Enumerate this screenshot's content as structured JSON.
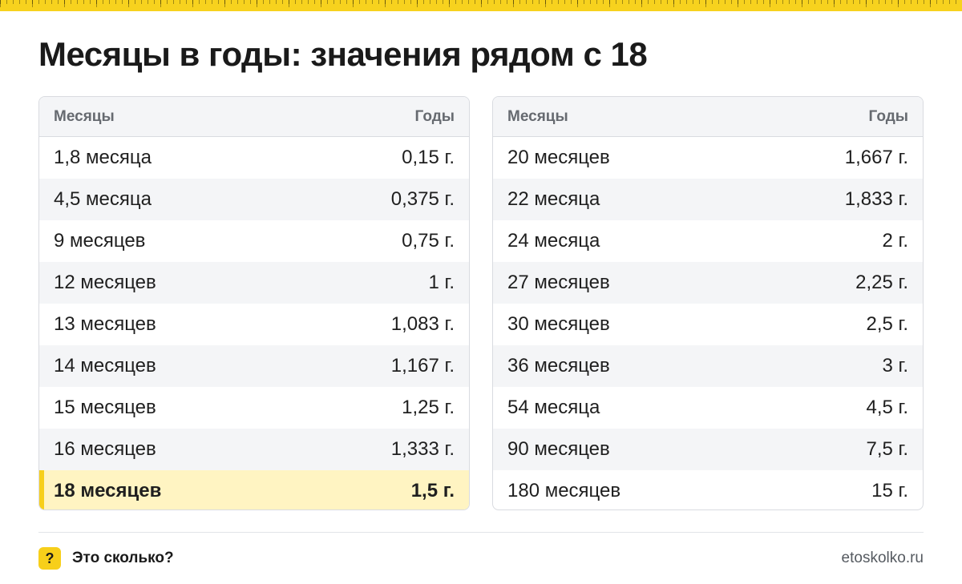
{
  "title": "Месяцы в годы: значения рядом с 18",
  "colors": {
    "accent": "#f7cf1a",
    "highlight_bg": "#fff4c2",
    "header_bg": "#f4f5f7"
  },
  "tables": [
    {
      "headers": {
        "months": "Месяцы",
        "years": "Годы"
      },
      "rows": [
        {
          "months": "1,8 месяца",
          "years": "0,15 г."
        },
        {
          "months": "4,5 месяца",
          "years": "0,375 г."
        },
        {
          "months": "9 месяцев",
          "years": "0,75 г."
        },
        {
          "months": "12 месяцев",
          "years": "1 г."
        },
        {
          "months": "13 месяцев",
          "years": "1,083 г."
        },
        {
          "months": "14 месяцев",
          "years": "1,167 г."
        },
        {
          "months": "15 месяцев",
          "years": "1,25 г."
        },
        {
          "months": "16 месяцев",
          "years": "1,333 г."
        },
        {
          "months": "18 месяцев",
          "years": "1,5 г."
        }
      ]
    },
    {
      "headers": {
        "months": "Месяцы",
        "years": "Годы"
      },
      "rows": [
        {
          "months": "20 месяцев",
          "years": "1,667 г."
        },
        {
          "months": "22 месяца",
          "years": "1,833 г."
        },
        {
          "months": "24 месяца",
          "years": "2 г."
        },
        {
          "months": "27 месяцев",
          "years": "2,25 г."
        },
        {
          "months": "30 месяцев",
          "years": "2,5 г."
        },
        {
          "months": "36 месяцев",
          "years": "3 г."
        },
        {
          "months": "54 месяца",
          "years": "4,5 г."
        },
        {
          "months": "90 месяцев",
          "years": "7,5 г."
        },
        {
          "months": "180 месяцев",
          "years": "15 г."
        }
      ]
    }
  ],
  "footer": {
    "badge": "?",
    "brand": "Это сколько?",
    "site": "etoskolko.ru"
  }
}
